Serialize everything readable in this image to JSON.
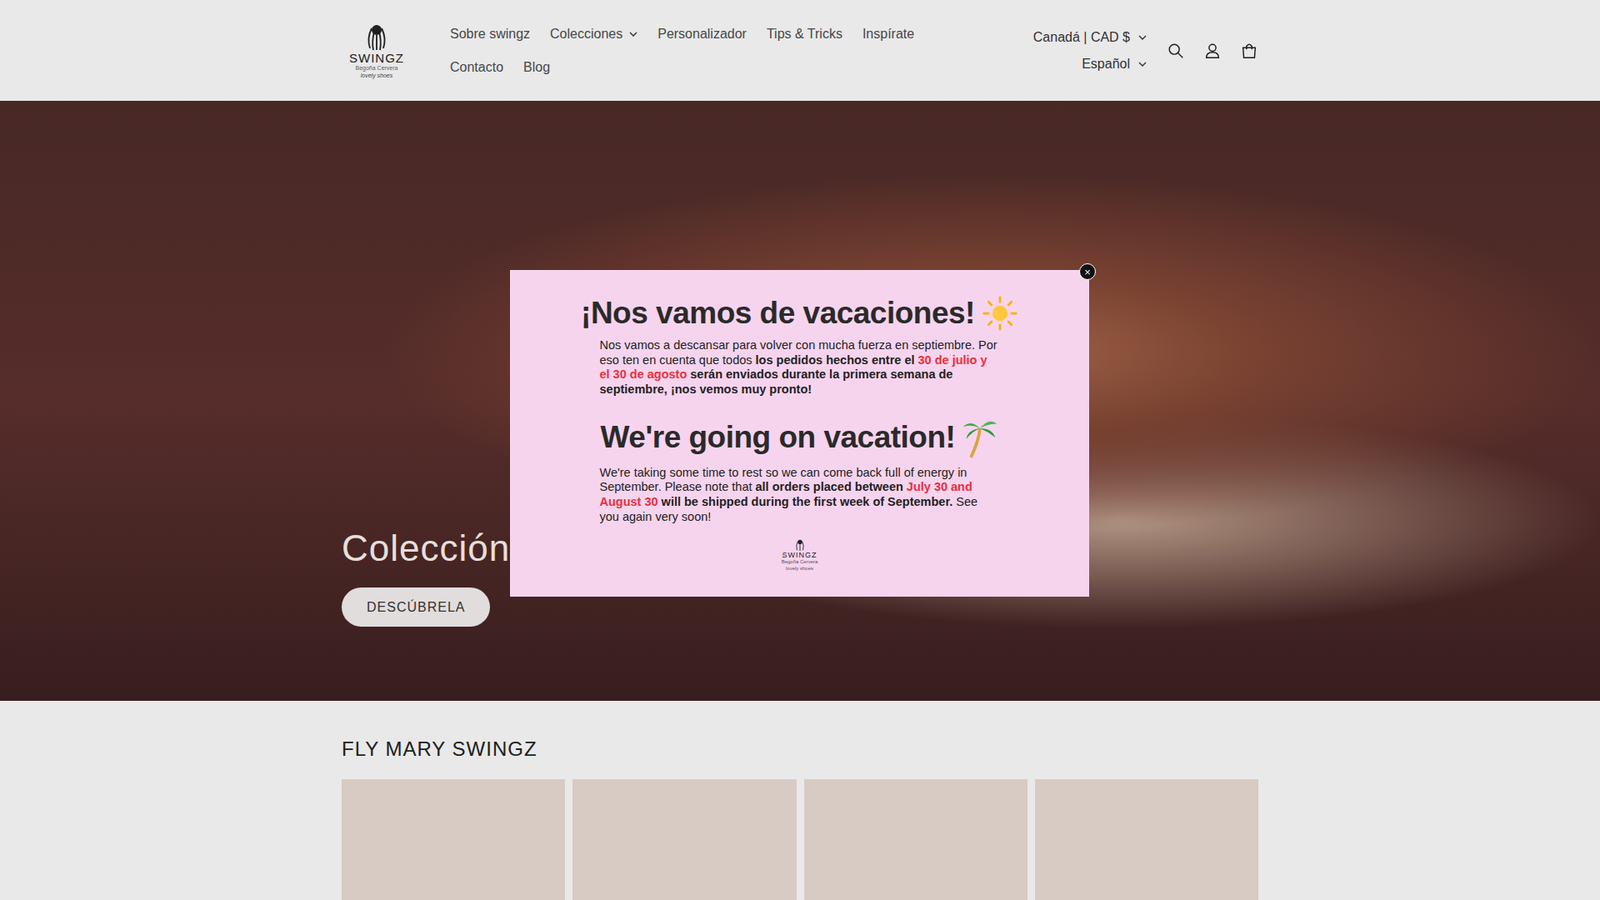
{
  "logo": {
    "brand": "SWINGZ",
    "designer": "Begoña Cervera",
    "tagline": "lovely shoes"
  },
  "nav": [
    {
      "label": "Sobre swingz",
      "dropdown": false
    },
    {
      "label": "Colecciones",
      "dropdown": true
    },
    {
      "label": "Personalizador",
      "dropdown": false
    },
    {
      "label": "Tips & Tricks",
      "dropdown": false
    },
    {
      "label": "Inspírate",
      "dropdown": false
    },
    {
      "label": "Contacto",
      "dropdown": false
    },
    {
      "label": "Blog",
      "dropdown": false
    }
  ],
  "selectors": [
    {
      "label": "Canadá | CAD $"
    },
    {
      "label": "Español"
    }
  ],
  "hero": {
    "title": "Colección",
    "button": "DESCÚBRELA"
  },
  "modal": {
    "close": "×",
    "sections": [
      {
        "heading": "¡Nos vamos de vacaciones!",
        "decoration": "sun",
        "spans": [
          {
            "text": "Nos vamos a descansar para volver con mucha fuerza en septiembre. Por eso ten en cuenta que todos ",
            "emphasis": "plain"
          },
          {
            "text": "los pedidos hechos entre el ",
            "emphasis": "bold"
          },
          {
            "text": "30 de julio y el 30 de agosto",
            "emphasis": "highlight"
          },
          {
            "text": " serán enviados durante la primera semana de septiembre, ¡nos vemos muy pronto!",
            "emphasis": "bold"
          }
        ]
      },
      {
        "heading": "We're going on vacation!",
        "decoration": "palm",
        "spans": [
          {
            "text": "We're taking some time to rest so we can come back full of energy in September. Please note that ",
            "emphasis": "plain"
          },
          {
            "text": "all orders placed between ",
            "emphasis": "bold"
          },
          {
            "text": "July 30 and August 30",
            "emphasis": "highlight"
          },
          {
            "text": " will be shipped during the first week of September.",
            "emphasis": "bold"
          },
          {
            "text": " See you again very soon!",
            "emphasis": "plain"
          }
        ]
      }
    ]
  },
  "featured": {
    "title": "FLY MARY SWINGZ",
    "products": [
      {
        "placeholder": true
      },
      {
        "placeholder": true
      },
      {
        "placeholder": true
      },
      {
        "placeholder": true
      }
    ]
  }
}
